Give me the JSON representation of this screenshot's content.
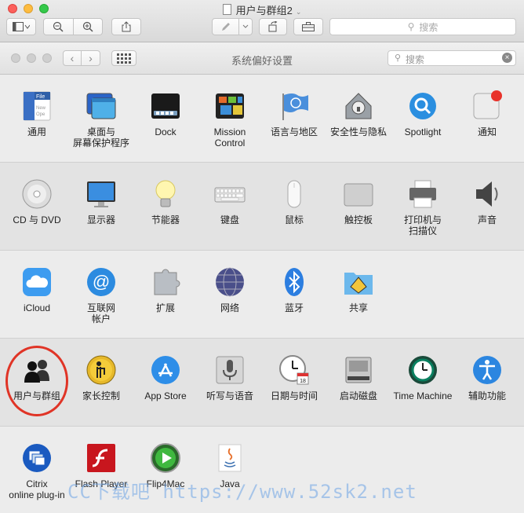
{
  "window": {
    "title": "用户与群组2"
  },
  "toolbar": {
    "search_placeholder": "搜索"
  },
  "prefs": {
    "title": "系统偏好设置",
    "search_placeholder": "搜索"
  },
  "sections": [
    {
      "items": [
        {
          "label": "通用",
          "icon": "general-icon"
        },
        {
          "label": "桌面与\n屏幕保护程序",
          "icon": "desktop-icon"
        },
        {
          "label": "Dock",
          "icon": "dock-icon"
        },
        {
          "label": "Mission\nControl",
          "icon": "mission-control-icon"
        },
        {
          "label": "语言与地区",
          "icon": "flag-icon"
        },
        {
          "label": "安全性与隐私",
          "icon": "house-lock-icon"
        },
        {
          "label": "Spotlight",
          "icon": "magnifier-icon"
        },
        {
          "label": "通知",
          "icon": "notification-icon"
        }
      ]
    },
    {
      "items": [
        {
          "label": "CD 与 DVD",
          "icon": "disc-icon"
        },
        {
          "label": "显示器",
          "icon": "monitor-icon"
        },
        {
          "label": "节能器",
          "icon": "bulb-icon"
        },
        {
          "label": "键盘",
          "icon": "keyboard-icon"
        },
        {
          "label": "鼠标",
          "icon": "mouse-icon"
        },
        {
          "label": "触控板",
          "icon": "trackpad-icon"
        },
        {
          "label": "打印机与\n扫描仪",
          "icon": "printer-icon"
        },
        {
          "label": "声音",
          "icon": "speaker-icon"
        }
      ]
    },
    {
      "items": [
        {
          "label": "iCloud",
          "icon": "cloud-icon"
        },
        {
          "label": "互联网\n帐户",
          "icon": "at-icon"
        },
        {
          "label": "扩展",
          "icon": "puzzle-icon"
        },
        {
          "label": "网络",
          "icon": "globe-icon"
        },
        {
          "label": "蓝牙",
          "icon": "bluetooth-icon"
        },
        {
          "label": "共享",
          "icon": "sharing-folder-icon"
        }
      ]
    },
    {
      "items": [
        {
          "label": "用户与群组",
          "icon": "users-icon"
        },
        {
          "label": "家长控制",
          "icon": "parental-icon"
        },
        {
          "label": "App Store",
          "icon": "app-store-icon"
        },
        {
          "label": "听写与语音",
          "icon": "microphone-icon"
        },
        {
          "label": "日期与时间",
          "icon": "clock-icon"
        },
        {
          "label": "启动磁盘",
          "icon": "disk-icon"
        },
        {
          "label": "Time Machine",
          "icon": "time-machine-icon"
        },
        {
          "label": "辅助功能",
          "icon": "accessibility-icon"
        }
      ]
    },
    {
      "items": [
        {
          "label": "Citrix\nonline plug-in",
          "icon": "citrix-icon"
        },
        {
          "label": "Flash Player",
          "icon": "flash-icon"
        },
        {
          "label": "Flip4Mac",
          "icon": "flip4mac-icon"
        },
        {
          "label": "Java",
          "icon": "java-icon"
        }
      ]
    }
  ],
  "watermark": "CC下载吧 https://www.52sk2.net"
}
